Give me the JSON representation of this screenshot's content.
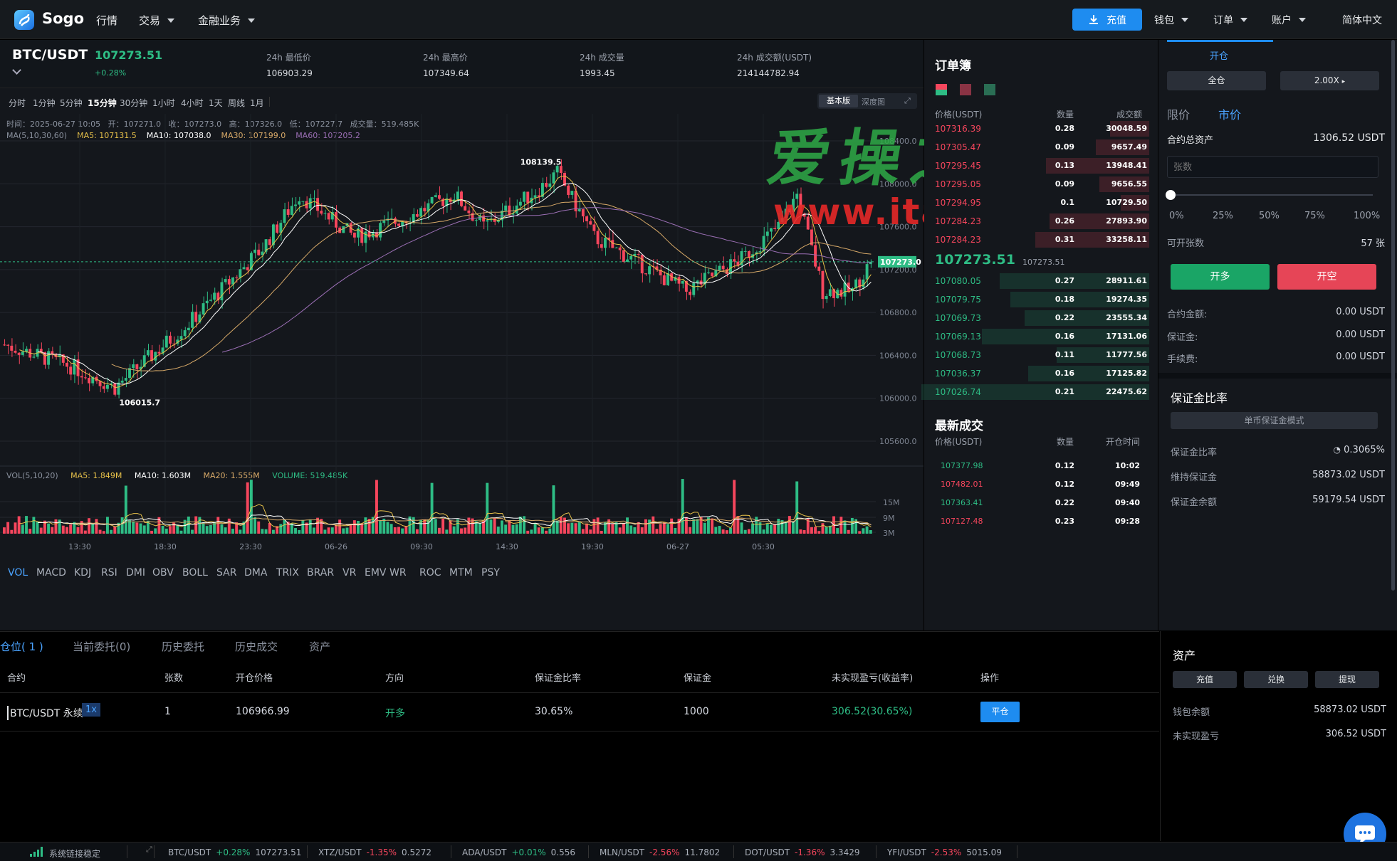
{
  "brand": {
    "name": "Sogo"
  },
  "nav": {
    "markets": "行情",
    "trade": "交易",
    "finance": "金融业务",
    "deposit": "充值",
    "wallet": "钱包",
    "orders": "订单",
    "account": "账户",
    "language": "简体中文"
  },
  "ticker": {
    "pair": "BTC/USDT",
    "price": "107273.51",
    "change": "+0.28%",
    "low_label": "24h 最低价",
    "low": "106903.29",
    "high_label": "24h 最高价",
    "high": "107349.64",
    "vol_label": "24h 成交量",
    "vol": "1993.45",
    "amount_label": "24h 成交额(USDT)",
    "amount": "214144782.94"
  },
  "timeframes": [
    "分时",
    "1分钟",
    "5分钟",
    "15分钟",
    "30分钟",
    "1小时",
    "4小时",
    "1天",
    "周线",
    "1月"
  ],
  "active_timeframe": "15分钟",
  "chart_tabs": {
    "basic": "基本版",
    "depth": "深度图"
  },
  "ohlc_info": {
    "time": "时间：2025-06-27 10:05",
    "open": "开：107271.0",
    "close": "收：107273.0",
    "high": "高：107326.0",
    "low": "低：107227.7",
    "volume": "成交量：519.485K"
  },
  "ma_info": {
    "label": "MA(5,10,30,60)",
    "ma5": "MA5: 107131.5",
    "ma10": "MA10: 107038.0",
    "ma30": "MA30: 107199.0",
    "ma60": "MA60: 107205.2"
  },
  "vol_info": {
    "label": "VOL(5,10,20)",
    "ma5": "MA5: 1.849M",
    "ma10": "MA10: 1.603M",
    "ma20": "MA20: 1.555M",
    "volume": "VOLUME: 519.485K"
  },
  "chart_labels": {
    "high_marker": "108139.5",
    "low_marker": "106015.7",
    "last_price": "107273.0",
    "price_axis": [
      "108400.0",
      "108000.0",
      "107600.0",
      "107200.0",
      "106800.0",
      "106400.0",
      "106000.0",
      "105600.0"
    ],
    "vol_axis": [
      "15M",
      "9M",
      "3M"
    ],
    "time_axis": [
      "13:30",
      "18:30",
      "23:30",
      "06-26",
      "09:30",
      "14:30",
      "19:30",
      "06-27",
      "05:30"
    ]
  },
  "chart_data": {
    "type": "candlestick",
    "interval": "15分钟",
    "y_axis_ticks": [
      108400,
      108000,
      107600,
      107200,
      106800,
      106400,
      106000,
      105600
    ],
    "ylim": [
      105600,
      108400
    ],
    "high": 108139.5,
    "low": 106015.7,
    "last": 107273.0,
    "x_ticks": [
      "13:30",
      "18:30",
      "23:30",
      "06-26",
      "09:30",
      "14:30",
      "19:30",
      "06-27",
      "05:30"
    ],
    "series": [
      {
        "name": "MA5",
        "color": "#e8c24a"
      },
      {
        "name": "MA10",
        "color": "#ffffff"
      },
      {
        "name": "MA30",
        "color": "#d7a968"
      },
      {
        "name": "MA60",
        "color": "#9b6fb5"
      }
    ],
    "volume_ticks": [
      "15M",
      "9M",
      "3M"
    ],
    "colors": {
      "up": "#2ebd85",
      "down": "#f6465d"
    }
  },
  "indicators": [
    "VOL",
    "MACD",
    "KDJ",
    "RSI",
    "DMI",
    "OBV",
    "BOLL",
    "SAR",
    "DMA",
    "TRIX",
    "BRAR",
    "VR",
    "EMV",
    "WR",
    "ROC",
    "MTM",
    "PSY"
  ],
  "orderbook": {
    "title": "订单簿",
    "col_price": "价格(USDT)",
    "col_qty": "数量",
    "col_amount": "成交额",
    "asks": [
      {
        "price": "107316.39",
        "qty": "0.28",
        "amount": "30048.59"
      },
      {
        "price": "107305.47",
        "qty": "0.09",
        "amount": "9657.49"
      },
      {
        "price": "107295.45",
        "qty": "0.13",
        "amount": "13948.41"
      },
      {
        "price": "107295.05",
        "qty": "0.09",
        "amount": "9656.55"
      },
      {
        "price": "107294.95",
        "qty": "0.1",
        "amount": "10729.50"
      },
      {
        "price": "107284.23",
        "qty": "0.26",
        "amount": "27893.90"
      },
      {
        "price": "107284.23",
        "qty": "0.31",
        "amount": "33258.11"
      }
    ],
    "last_price": "107273.51",
    "last_price_small": "107273.51",
    "bids": [
      {
        "price": "107080.05",
        "qty": "0.27",
        "amount": "28911.61"
      },
      {
        "price": "107079.75",
        "qty": "0.18",
        "amount": "19274.35"
      },
      {
        "price": "107069.73",
        "qty": "0.22",
        "amount": "23555.34"
      },
      {
        "price": "107069.13",
        "qty": "0.16",
        "amount": "17131.06"
      },
      {
        "price": "107068.73",
        "qty": "0.11",
        "amount": "11777.56"
      },
      {
        "price": "107036.37",
        "qty": "0.16",
        "amount": "17125.82"
      },
      {
        "price": "107026.74",
        "qty": "0.21",
        "amount": "22475.62"
      }
    ]
  },
  "trades": {
    "title": "最新成交",
    "col_price": "价格(USDT)",
    "col_qty": "数量",
    "col_time": "开仓时间",
    "rows": [
      {
        "price": "107377.98",
        "qty": "0.12",
        "time": "10:02",
        "side": "buy"
      },
      {
        "price": "107482.01",
        "qty": "0.12",
        "time": "09:49",
        "side": "sell"
      },
      {
        "price": "107363.41",
        "qty": "0.22",
        "time": "09:40",
        "side": "buy"
      },
      {
        "price": "107127.48",
        "qty": "0.23",
        "time": "09:28",
        "side": "sell"
      }
    ]
  },
  "trade_panel": {
    "tab_open": "开仓",
    "margin_mode": "全仓",
    "leverage": "2.00X",
    "limit": "限价",
    "market": "市价",
    "total_assets_label": "合约总资产",
    "total_assets": "1306.52 USDT",
    "qty_placeholder": "张数",
    "slider_marks": [
      "0%",
      "25%",
      "50%",
      "75%",
      "100%"
    ],
    "slider_level": 0,
    "available_label": "可开张数",
    "available": "57 张",
    "btn_long": "开多",
    "btn_short": "开空",
    "contract_amount_label": "合约金额:",
    "contract_amount": "0.00 USDT",
    "margin_label": "保证金:",
    "margin": "0.00 USDT",
    "fee_label": "手续费:",
    "fee": "0.00 USDT"
  },
  "margin_ratio": {
    "title": "保证金比率",
    "mode": "单币保证金模式",
    "ratio_label": "保证金比率",
    "ratio": "0.3065%",
    "maint_label": "维持保证金",
    "maint": "58873.02 USDT",
    "balance_label": "保证金余额",
    "balance": "59179.54 USDT"
  },
  "positions": {
    "tabs": [
      "仓位( 1 )",
      "当前委托(0)",
      "历史委托",
      "历史成交",
      "资产"
    ],
    "headers": [
      "合约",
      "张数",
      "开仓价格",
      "方向",
      "保证金比率",
      "保证金",
      "未实现盈亏(收益率)",
      "操作"
    ],
    "row": {
      "contract": "BTC/USDT 永续",
      "leverage": "1x",
      "qty": "1",
      "open_price": "106966.99",
      "direction": "开多",
      "margin_ratio": "30.65%",
      "margin": "1000",
      "pnl": "306.52(30.65%)",
      "action": "平仓"
    }
  },
  "assets": {
    "title": "资产",
    "deposit": "充值",
    "exchange": "兑换",
    "withdraw": "提现",
    "wallet_label": "钱包余额",
    "wallet": "58873.02 USDT",
    "pnl_label": "未实现盈亏",
    "pnl": "306.52 USDT"
  },
  "watermark": {
    "line1": "爱操之家",
    "line2": "www.itan.cc"
  },
  "statusbar": {
    "connection": "系统链接稳定",
    "tickers": [
      {
        "pair": "BTC/USDT",
        "change": "+0.28%",
        "price": "107273.51",
        "up": true
      },
      {
        "pair": "XTZ/USDT",
        "change": "-1.35%",
        "price": "0.5272",
        "up": false
      },
      {
        "pair": "ADA/USDT",
        "change": "+0.01%",
        "price": "0.556",
        "up": true
      },
      {
        "pair": "MLN/USDT",
        "change": "-2.56%",
        "price": "11.7802",
        "up": false
      },
      {
        "pair": "DOT/USDT",
        "change": "-1.36%",
        "price": "3.3429",
        "up": false
      },
      {
        "pair": "YFI/USDT",
        "change": "-2.53%",
        "price": "5015.09",
        "up": false
      }
    ]
  }
}
